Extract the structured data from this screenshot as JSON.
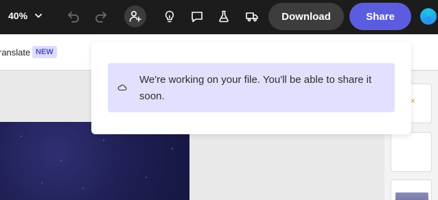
{
  "toolbar": {
    "zoom_value": "40%",
    "icons": [
      "undo-icon",
      "redo-icon",
      "invite-user-icon",
      "lightbulb-icon",
      "comment-icon",
      "flask-icon",
      "truck-icon"
    ],
    "download_label": "Download",
    "share_label": "Share"
  },
  "subbar": {
    "translate_label": "ranslate",
    "new_badge": "NEW"
  },
  "notification": {
    "message": "We're working on your file. You'll be able to share it soon.",
    "icon": "cloud-icon"
  },
  "colors": {
    "toolbar_bg": "#1c1c1c",
    "share_accent": "#5c5ce0",
    "notice_bg": "#e1e1ff",
    "badge_bg": "#dcdcfb"
  }
}
